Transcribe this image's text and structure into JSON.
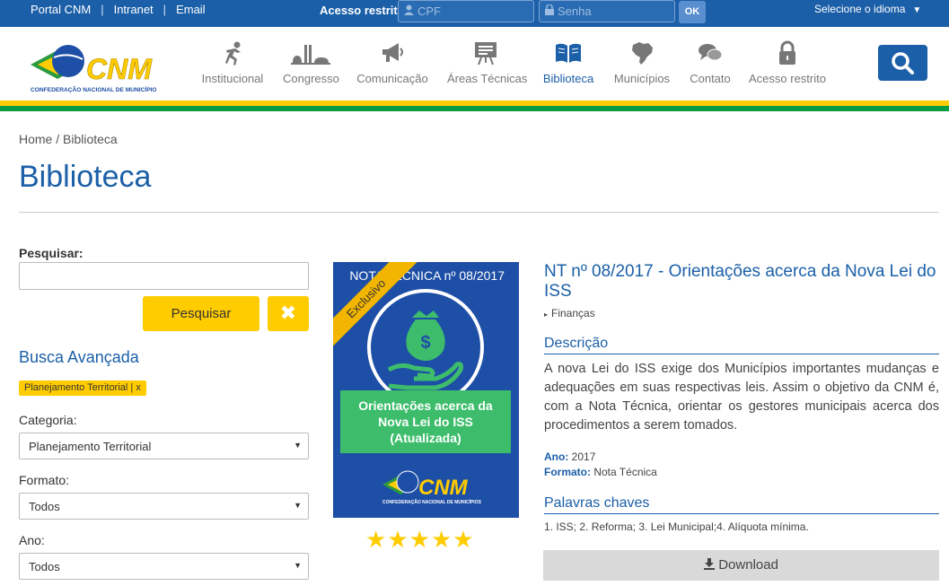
{
  "topbar": {
    "links": [
      "Portal CNM",
      "Intranet",
      "Email"
    ],
    "acesso_label": "Acesso restrito",
    "cpf_placeholder": "CPF",
    "senha_placeholder": "Senha",
    "ok_label": "OK",
    "language_label": "Selecione o idioma"
  },
  "logo": {
    "text": "CNM",
    "subtitle": "CONFEDERAÇÃO NACIONAL DE MUNICÍPIOS"
  },
  "nav": {
    "items": [
      {
        "label": "Institucional",
        "icon": "figure-icon"
      },
      {
        "label": "Congresso",
        "icon": "congress-icon"
      },
      {
        "label": "Comunicação",
        "icon": "megaphone-icon"
      },
      {
        "label": "Áreas Técnicas",
        "icon": "presentation-board-icon"
      },
      {
        "label": "Biblioteca",
        "icon": "open-book-icon",
        "active": true
      },
      {
        "label": "Municípios",
        "icon": "brazil-map-icon"
      },
      {
        "label": "Contato",
        "icon": "chat-bubbles-icon"
      },
      {
        "label": "Acesso restrito",
        "icon": "lock-icon"
      }
    ]
  },
  "colors": {
    "brand_blue": "#1b5fa8",
    "yellow": "#ffcc00",
    "green": "#0a9b45"
  },
  "breadcrumb": "Home / Biblioteca",
  "page_title": "Biblioteca",
  "sidebar": {
    "search_label": "Pesquisar:",
    "search_value": "",
    "search_button": "Pesquisar",
    "clear_button": "✖",
    "advanced_title": "Busca Avançada",
    "active_filter": "Planejamento Territorial | x",
    "categoria_label": "Categoria:",
    "categoria_value": "Planejamento Territorial",
    "formato_label": "Formato:",
    "formato_value": "Todos",
    "ano_label": "Ano:",
    "ano_value": "Todos"
  },
  "cover": {
    "header": "NOTA TÉCNICA nº 08/2017",
    "ribbon": "Exclusivo",
    "box_text": [
      "Orientações acerca da",
      "Nova Lei do ISS",
      "(Atualizada)"
    ],
    "logo_text": "CNM",
    "logo_subtitle": "CONFEDERAÇÃO NACIONAL DE MUNICÍPIOS"
  },
  "rating": {
    "stars": 5,
    "max": 5
  },
  "document": {
    "title": "NT nº 08/2017 - Orientações acerca da Nova Lei do ISS",
    "category": "Finanças",
    "desc_heading": "Descrição",
    "description": "A nova Lei do ISS exige dos Municípios importantes mudanças e adequações em suas respectivas leis. Assim o objetivo da CNM é, com a Nota Técnica, orientar os gestores municipais acerca dos procedimentos a serem tomados.",
    "ano_label": "Ano:",
    "ano_value": "2017",
    "formato_label": "Formato:",
    "formato_value": "Nota Técnica",
    "keywords_heading": "Palavras chaves",
    "keywords": "1. ISS; 2. Reforma; 3. Lei Municipal;4. Alíquota mínima.",
    "download_label": "Download"
  }
}
